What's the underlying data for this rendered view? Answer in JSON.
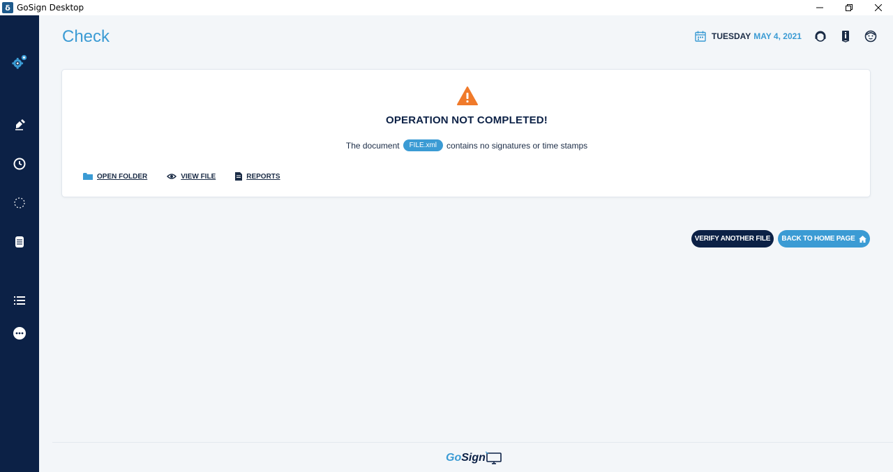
{
  "window": {
    "title": "GoSign Desktop",
    "app_icon_glyph": "δ"
  },
  "sidebar": {
    "items": [
      {
        "name": "settings-gear-icon"
      },
      {
        "name": "sign-pen-icon"
      },
      {
        "name": "clock-icon"
      },
      {
        "name": "loading-circle-icon"
      },
      {
        "name": "database-icon"
      },
      {
        "name": "list-icon"
      },
      {
        "name": "more-icon"
      }
    ]
  },
  "header": {
    "page_title": "Check",
    "date_day": "TUESDAY",
    "date_rest": "MAY 4, 2021"
  },
  "card": {
    "title": "OPERATION NOT COMPLETED!",
    "msg_prefix": "The document",
    "file_name": "FILE.xml",
    "msg_suffix": "contains no signatures or time stamps",
    "actions": {
      "open_folder": "OPEN FOLDER",
      "view_file": "VIEW FILE",
      "reports": "REPORTS"
    }
  },
  "buttons": {
    "verify_another": "VERIFY ANOTHER FILE",
    "back_home": "BACK TO HOME PAGE"
  },
  "footer": {
    "logo_go": "Go",
    "logo_sign": "Sign"
  },
  "colors": {
    "sidebar": "#0c2146",
    "accent": "#3b9bd4",
    "warning": "#f07a2a"
  }
}
